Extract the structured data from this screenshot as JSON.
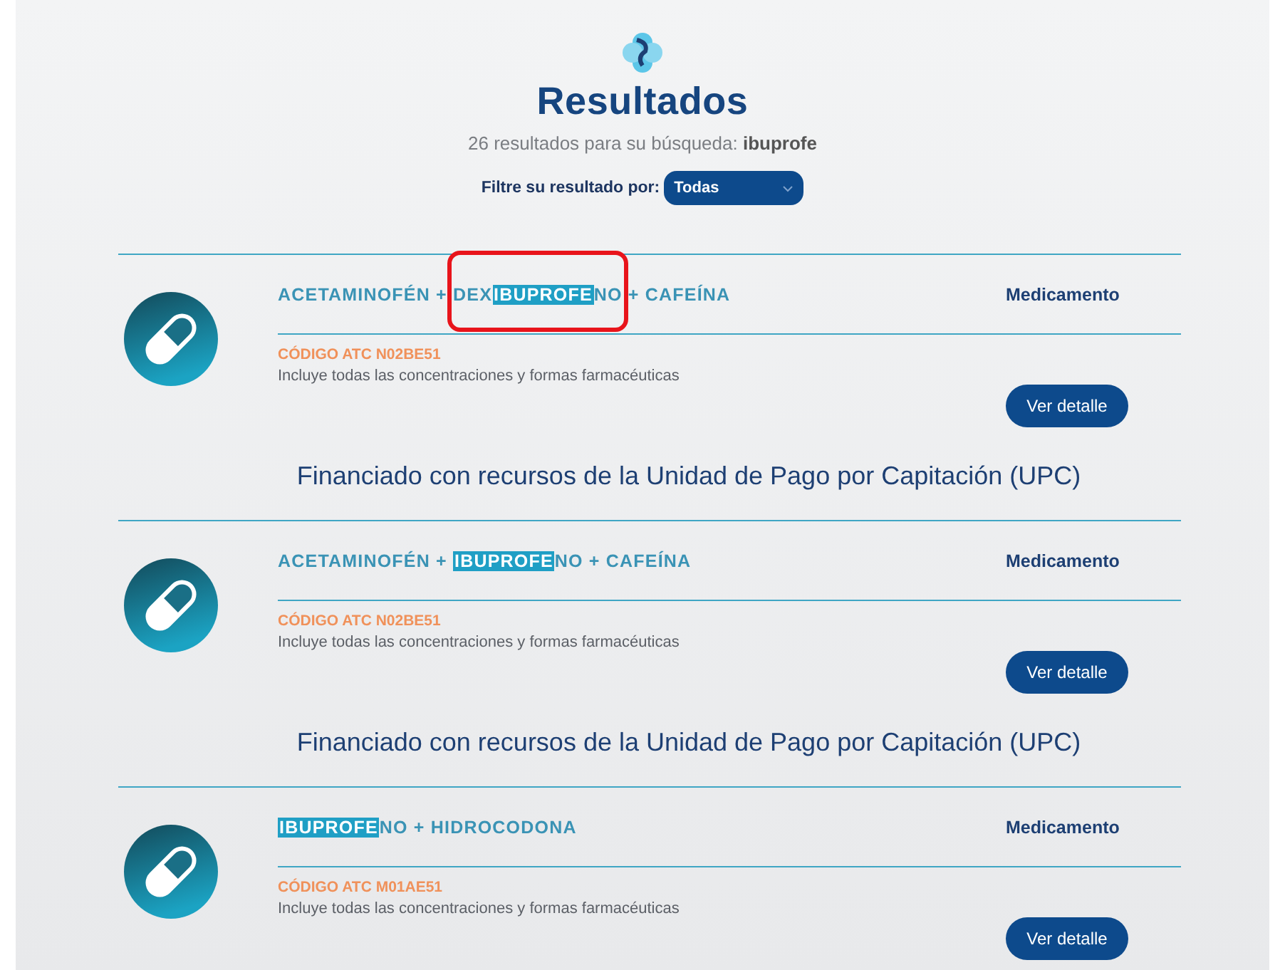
{
  "header": {
    "title": "Resultados",
    "summary": "26 resultados para su búsqueda:",
    "query": "ibuprofe",
    "filter_label": "Filtre su resultado por:",
    "filter_value": "Todas"
  },
  "results": [
    {
      "name_parts": [
        {
          "text": "ACETAMINOFÉN + DEX",
          "highlight": false
        },
        {
          "text": "IBUPROFE",
          "highlight": true,
          "annotated": true
        },
        {
          "text": "NO + CAFEÍNA",
          "highlight": false
        }
      ],
      "type": "Medicamento",
      "code": "CÓDIGO ATC N02BE51",
      "description": "Incluye todas las concentraciones y formas farmacéuticas",
      "button": "Ver detalle",
      "funding": "Financiado con recursos de la Unidad de Pago por Capitación (UPC)"
    },
    {
      "name_parts": [
        {
          "text": "ACETAMINOFÉN + ",
          "highlight": false
        },
        {
          "text": "IBUPROFE",
          "highlight": true,
          "annotated": false
        },
        {
          "text": "NO + CAFEÍNA",
          "highlight": false
        }
      ],
      "type": "Medicamento",
      "code": "CÓDIGO ATC N02BE51",
      "description": "Incluye todas las concentraciones y formas farmacéuticas",
      "button": "Ver detalle",
      "funding": "Financiado con recursos de la Unidad de Pago por Capitación (UPC)"
    },
    {
      "name_parts": [
        {
          "text": "IBUPROFE",
          "highlight": true,
          "annotated": false
        },
        {
          "text": "NO + HIDROCODONA",
          "highlight": false
        }
      ],
      "type": "Medicamento",
      "code": "CÓDIGO ATC M01AE51",
      "description": "Incluye todas las concentraciones y formas farmacéuticas",
      "button": "Ver detalle"
    }
  ]
}
